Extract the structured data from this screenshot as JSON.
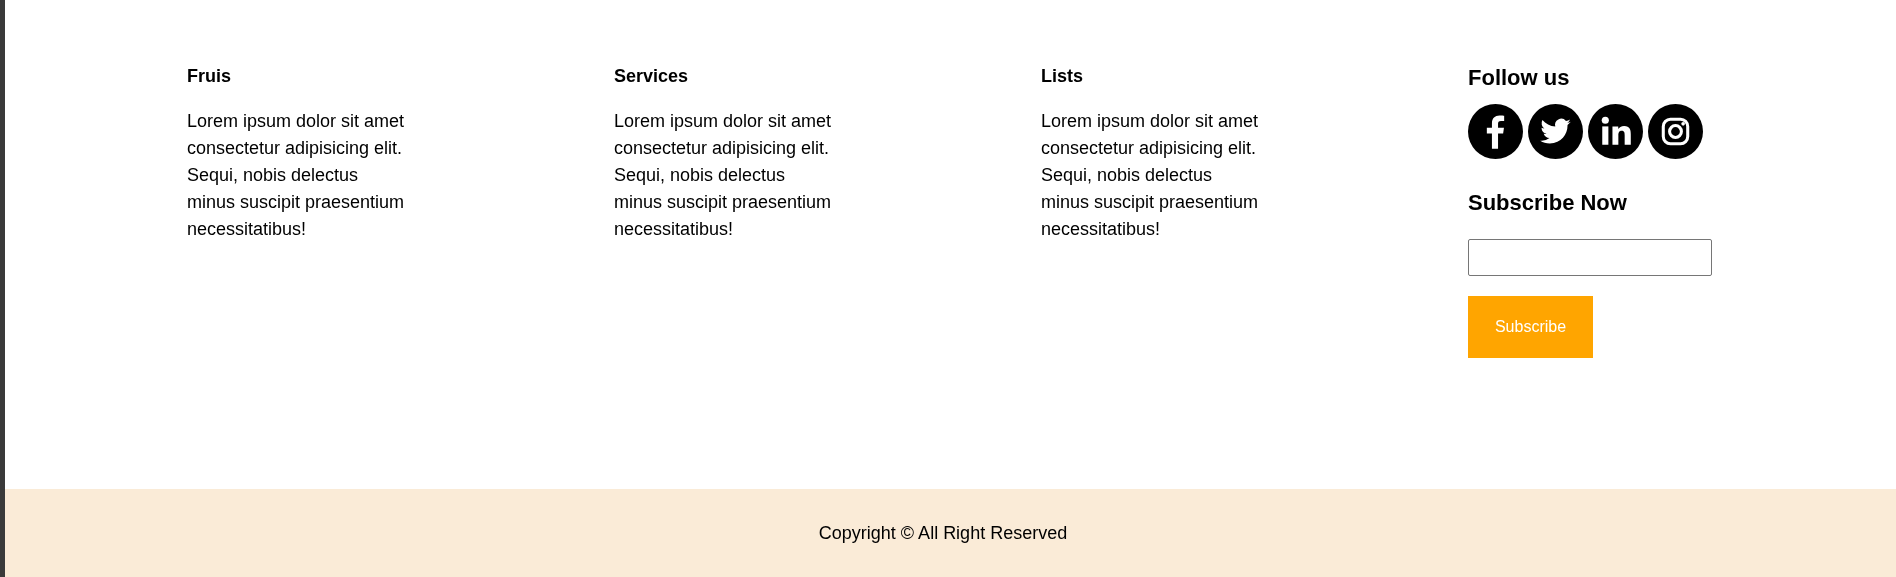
{
  "columns": [
    {
      "heading": "Fruis",
      "lines": [
        "Lorem ipsum dolor sit amet",
        "consectetur adipisicing elit.",
        "Sequi, nobis delectus",
        "minus suscipit praesentium",
        "necessitatibus!"
      ]
    },
    {
      "heading": "Services",
      "lines": [
        "Lorem ipsum dolor sit amet",
        "consectetur adipisicing elit.",
        "Sequi, nobis delectus",
        "minus suscipit praesentium",
        "necessitatibus!"
      ]
    },
    {
      "heading": "Lists",
      "lines": [
        "Lorem ipsum dolor sit amet",
        "consectetur adipisicing elit.",
        "Sequi, nobis delectus",
        "minus suscipit praesentium",
        "necessitatibus!"
      ]
    }
  ],
  "follow": {
    "heading": "Follow us",
    "icons": [
      {
        "kind": "facebook"
      },
      {
        "kind": "twitter"
      },
      {
        "kind": "linkedin"
      },
      {
        "kind": "instagram"
      }
    ]
  },
  "subscribe": {
    "heading": "Subscribe Now",
    "button": "Subscribe"
  },
  "footer": {
    "copyright": "Copyright © All Right Reserved"
  }
}
